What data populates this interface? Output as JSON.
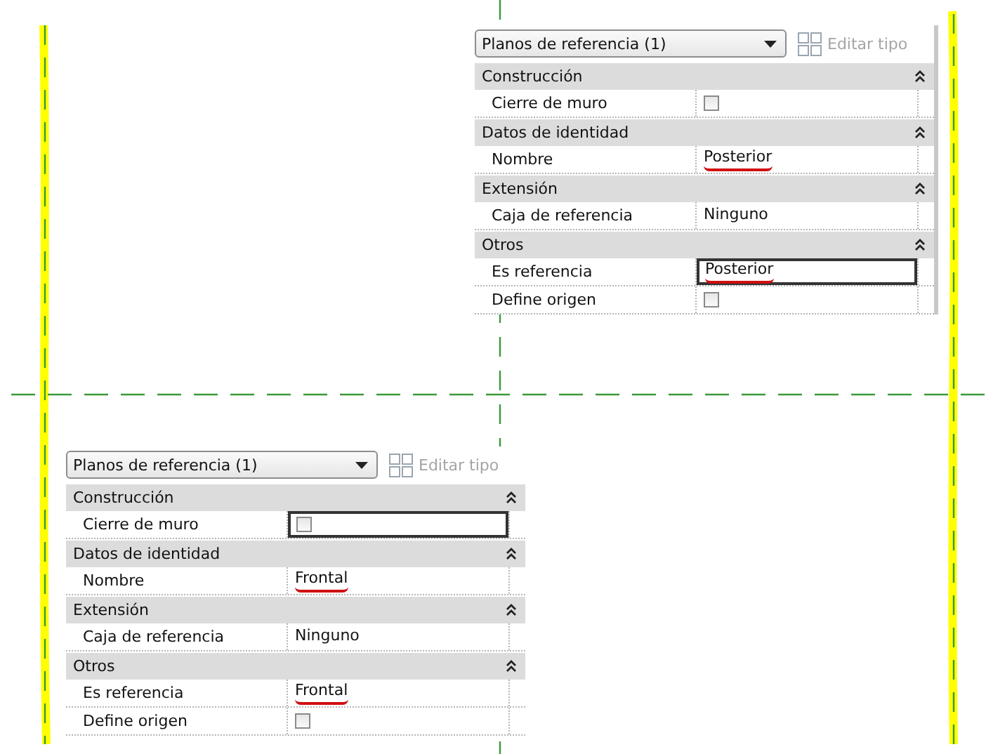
{
  "panels": [
    {
      "type_selector": "Planos de referencia (1)",
      "edit_type": {
        "label": "Editar tipo",
        "disabled": true
      },
      "groups": [
        {
          "title": "Construcción",
          "expanded": true,
          "rows": [
            {
              "label": "Cierre de muro",
              "kind": "checkbox",
              "checked": false,
              "active": false
            }
          ]
        },
        {
          "title": "Datos de identidad",
          "expanded": true,
          "rows": [
            {
              "label": "Nombre",
              "kind": "text",
              "value": "Posterior",
              "marked": true,
              "active": false
            }
          ]
        },
        {
          "title": "Extensión",
          "expanded": true,
          "rows": [
            {
              "label": "Caja de referencia",
              "kind": "text",
              "value": "Ninguno",
              "marked": false,
              "active": false
            }
          ]
        },
        {
          "title": "Otros",
          "expanded": true,
          "rows": [
            {
              "label": "Es referencia",
              "kind": "text",
              "value": "Posterior",
              "marked": true,
              "active": true
            },
            {
              "label": "Define origen",
              "kind": "checkbox",
              "checked": false,
              "active": false
            }
          ]
        }
      ]
    },
    {
      "type_selector": "Planos de referencia (1)",
      "edit_type": {
        "label": "Editar tipo",
        "disabled": true
      },
      "groups": [
        {
          "title": "Construcción",
          "expanded": true,
          "rows": [
            {
              "label": "Cierre de muro",
              "kind": "checkbox",
              "checked": false,
              "active": true
            }
          ]
        },
        {
          "title": "Datos de identidad",
          "expanded": true,
          "rows": [
            {
              "label": "Nombre",
              "kind": "text",
              "value": "Frontal",
              "marked": true,
              "active": false
            }
          ]
        },
        {
          "title": "Extensión",
          "expanded": true,
          "rows": [
            {
              "label": "Caja de referencia",
              "kind": "text",
              "value": "Ninguno",
              "marked": false,
              "active": false
            }
          ]
        },
        {
          "title": "Otros",
          "expanded": true,
          "rows": [
            {
              "label": "Es referencia",
              "kind": "text",
              "value": "Frontal",
              "marked": true,
              "active": false
            },
            {
              "label": "Define origen",
              "kind": "checkbox",
              "checked": false,
              "active": false
            }
          ]
        }
      ]
    }
  ]
}
